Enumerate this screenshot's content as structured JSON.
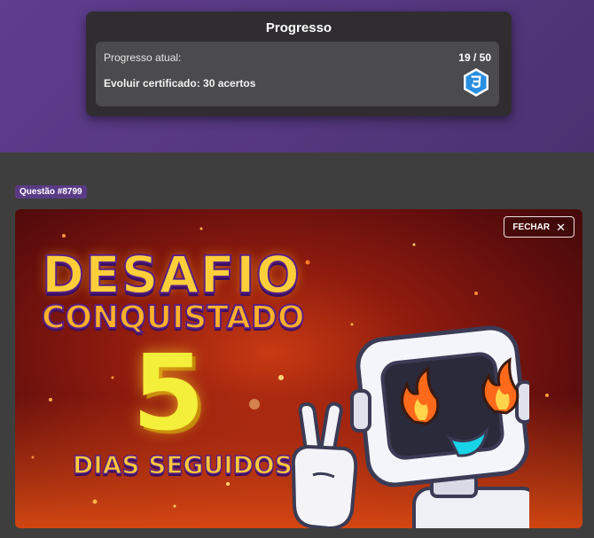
{
  "progress": {
    "title": "Progresso",
    "current_label": "Progresso atual:",
    "current_value": "19 / 50",
    "progress_fraction": 0.38,
    "certificate_label": "Evoluir certificado: 30 acertos",
    "badge_icon": "css3-badge-icon",
    "badge_color": "#2a8ee0"
  },
  "question": {
    "tag": "Questão #8799"
  },
  "banner": {
    "close_label": "FECHAR",
    "close_icon": "close-icon",
    "title_line1": "DESAFIO",
    "title_line2": "CONQUISTADO",
    "streak_number": "5",
    "streak_label": "DIAS SEGUIDOS",
    "mascot": "robot-mascot-with-flame-eyes",
    "accent_colors": {
      "title": "#ffcf3a",
      "outline": "#5a1f84",
      "number": "#f3ef3a"
    }
  },
  "colors": {
    "top_band": "#5a3a88",
    "card_bg": "#2f2d30",
    "page_bg": "#3e3e3e",
    "tag_bg": "#5a3b86"
  }
}
